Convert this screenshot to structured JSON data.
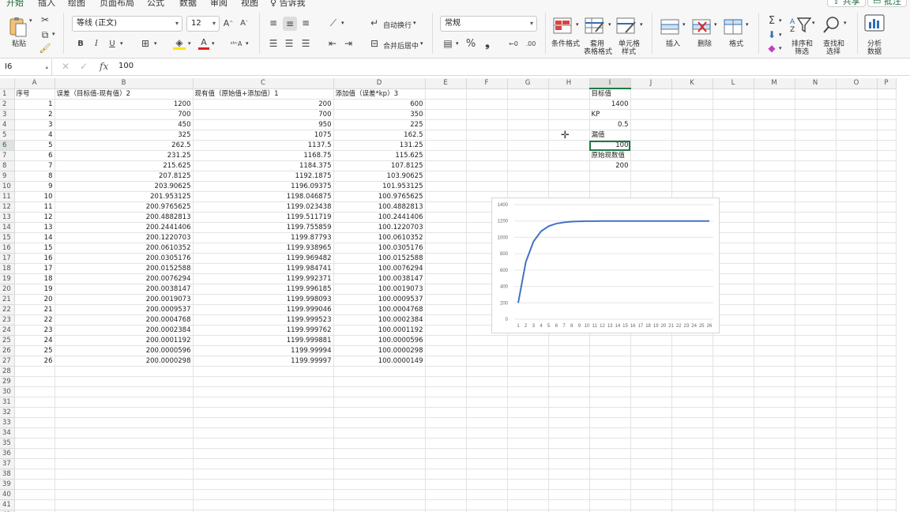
{
  "tabs": [
    "开始",
    "插入",
    "绘图",
    "页面布局",
    "公式",
    "数据",
    "审阅",
    "视图",
    "告诉我"
  ],
  "share_label": "共享",
  "comment_label": "批注",
  "ribbon": {
    "paste": "粘贴",
    "font_name": "等线 (正文)",
    "font_size": "12",
    "bold": "B",
    "italic": "I",
    "underline": "U",
    "wrap_text": "自动换行",
    "merge_center": "合并后居中",
    "number_format": "常规",
    "percent": "%",
    "comma": "❟",
    "conditional_format": "条件格式",
    "table_format_1": "套用",
    "table_format_2": "表格格式",
    "cell_style_1": "单元格",
    "cell_style_2": "样式",
    "insert": "插入",
    "delete": "删除",
    "format": "格式",
    "sort_filter_1": "排序和",
    "sort_filter_2": "筛选",
    "find_select_1": "查找和",
    "find_select_2": "选择",
    "analyze_1": "分析",
    "analyze_2": "数据"
  },
  "formula_bar": {
    "name_box": "I6",
    "fx": "fx",
    "formula": "100"
  },
  "columns": [
    "A",
    "B",
    "C",
    "D",
    "E",
    "F",
    "G",
    "H",
    "I",
    "J",
    "K",
    "L",
    "M",
    "N",
    "O",
    "P"
  ],
  "headers": {
    "A": "序号",
    "B": "误差（目标值-现有值）2",
    "C": "现有值（原始值+添加值）1",
    "D": "添加值（误差*kp）3"
  },
  "rows": [
    [
      "1",
      "1200",
      "200",
      "600"
    ],
    [
      "2",
      "700",
      "700",
      "350"
    ],
    [
      "3",
      "450",
      "950",
      "225"
    ],
    [
      "4",
      "325",
      "1075",
      "162.5"
    ],
    [
      "5",
      "262.5",
      "1137.5",
      "131.25"
    ],
    [
      "6",
      "231.25",
      "1168.75",
      "115.625"
    ],
    [
      "7",
      "215.625",
      "1184.375",
      "107.8125"
    ],
    [
      "8",
      "207.8125",
      "1192.1875",
      "103.90625"
    ],
    [
      "9",
      "203.90625",
      "1196.09375",
      "101.953125"
    ],
    [
      "10",
      "201.953125",
      "1198.046875",
      "100.9765625"
    ],
    [
      "11",
      "200.9765625",
      "1199.023438",
      "100.4882813"
    ],
    [
      "12",
      "200.4882813",
      "1199.511719",
      "100.2441406"
    ],
    [
      "13",
      "200.2441406",
      "1199.755859",
      "100.1220703"
    ],
    [
      "14",
      "200.1220703",
      "1199.87793",
      "100.0610352"
    ],
    [
      "15",
      "200.0610352",
      "1199.938965",
      "100.0305176"
    ],
    [
      "16",
      "200.0305176",
      "1199.969482",
      "100.0152588"
    ],
    [
      "17",
      "200.0152588",
      "1199.984741",
      "100.0076294"
    ],
    [
      "18",
      "200.0076294",
      "1199.992371",
      "100.0038147"
    ],
    [
      "19",
      "200.0038147",
      "1199.996185",
      "100.0019073"
    ],
    [
      "20",
      "200.0019073",
      "1199.998093",
      "100.0009537"
    ],
    [
      "21",
      "200.0009537",
      "1199.999046",
      "100.0004768"
    ],
    [
      "22",
      "200.0004768",
      "1199.999523",
      "100.0002384"
    ],
    [
      "23",
      "200.0002384",
      "1199.999762",
      "100.0001192"
    ],
    [
      "24",
      "200.0001192",
      "1199.999881",
      "100.0000596"
    ],
    [
      "25",
      "200.0000596",
      "1199.99994",
      "100.0000298"
    ],
    [
      "26",
      "200.0000298",
      "1199.99997",
      "100.0000149"
    ]
  ],
  "side_cells": [
    {
      "row": 1,
      "col": "I",
      "value": "目标值",
      "align": "left"
    },
    {
      "row": 2,
      "col": "I",
      "value": "1400",
      "align": "right"
    },
    {
      "row": 3,
      "col": "I",
      "value": "KP",
      "align": "left"
    },
    {
      "row": 4,
      "col": "I",
      "value": "0.5",
      "align": "right"
    },
    {
      "row": 5,
      "col": "I",
      "value": "漏值",
      "align": "left"
    },
    {
      "row": 6,
      "col": "I",
      "value": "100",
      "align": "right"
    },
    {
      "row": 7,
      "col": "I",
      "value": "原始现数值",
      "align": "left"
    },
    {
      "row": 8,
      "col": "I",
      "value": "200",
      "align": "right"
    }
  ],
  "active_cell": {
    "row": 6,
    "col": "I"
  },
  "row_count": 42,
  "chart_data": {
    "type": "line",
    "x": [
      "1",
      "2",
      "3",
      "4",
      "5",
      "6",
      "7",
      "8",
      "9",
      "10",
      "11",
      "12",
      "13",
      "14",
      "15",
      "16",
      "17",
      "18",
      "19",
      "20",
      "21",
      "22",
      "23",
      "24",
      "25",
      "26"
    ],
    "series": [
      {
        "values": [
          200,
          700,
          950,
          1075,
          1137.5,
          1168.75,
          1184.375,
          1192.1875,
          1196.09375,
          1198.046875,
          1199.023438,
          1199.511719,
          1199.755859,
          1199.87793,
          1199.938965,
          1199.969482,
          1199.984741,
          1199.992371,
          1199.996185,
          1199.998093,
          1199.999046,
          1199.999523,
          1199.999762,
          1199.999881,
          1199.99994,
          1199.99997
        ]
      }
    ],
    "y_ticks": [
      "0",
      "200",
      "400",
      "600",
      "800",
      "1000",
      "1200",
      "1400"
    ],
    "ylim": [
      0,
      1400
    ],
    "grid": true,
    "legend": false,
    "color": "#4472c4"
  }
}
